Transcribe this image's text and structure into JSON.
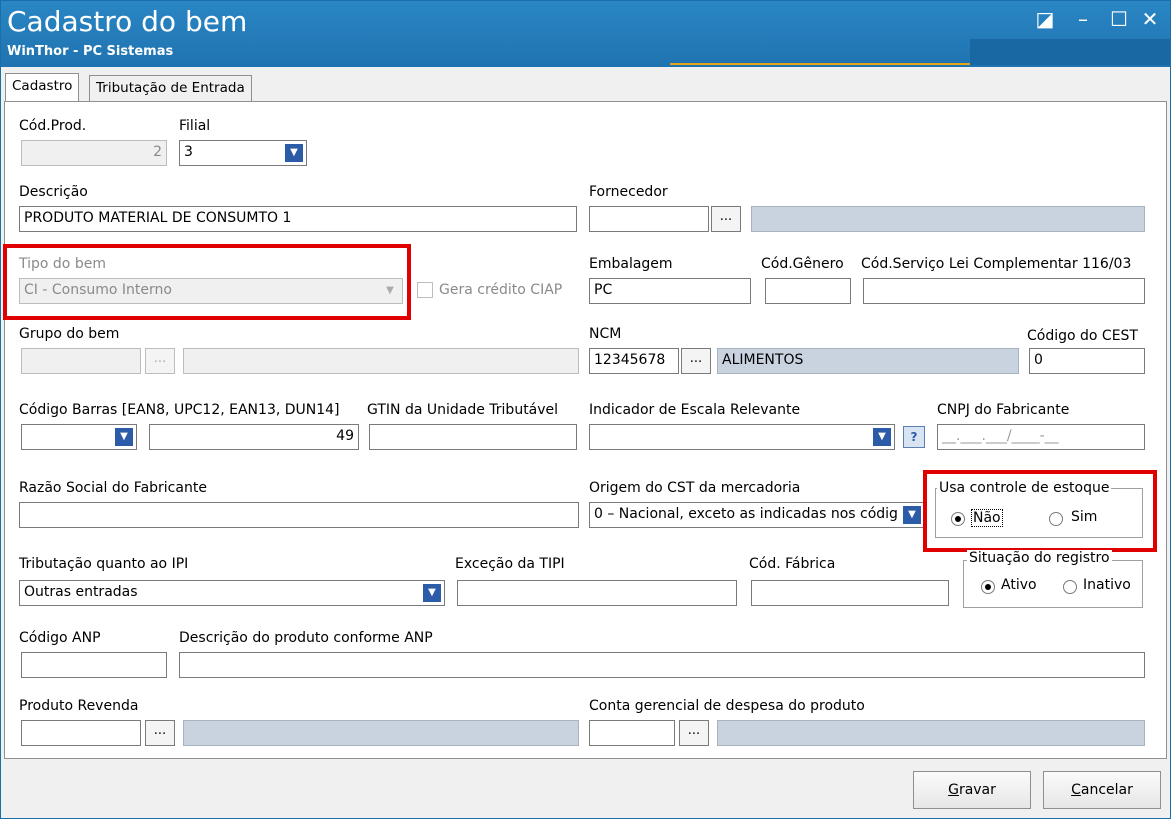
{
  "window": {
    "title": "Cadastro do bem",
    "subtitle": "WinThor - PC Sistemas",
    "controls": {
      "restore": "◪",
      "minimize": "–",
      "maximize": "☐",
      "close": "✕"
    }
  },
  "tabs": [
    {
      "label": "Cadastro",
      "active": true
    },
    {
      "label": "Tributação de Entrada",
      "active": false
    }
  ],
  "form": {
    "cod_prod": {
      "label": "Cód.Prod.",
      "value": "2"
    },
    "filial": {
      "label": "Filial",
      "value": "3"
    },
    "descricao": {
      "label": "Descrição",
      "value": "PRODUTO MATERIAL DE CONSUMTO 1"
    },
    "fornecedor": {
      "label": "Fornecedor",
      "value": "",
      "button": "..."
    },
    "tipo_bem": {
      "label": "Tipo do bem",
      "value": "CI - Consumo Interno"
    },
    "gera_credito": {
      "label": "Gera crédito CIAP",
      "checked": false
    },
    "embalagem": {
      "label": "Embalagem",
      "value": "PC"
    },
    "cod_genero": {
      "label": "Cód.Gênero",
      "value": ""
    },
    "cod_servico": {
      "label": "Cód.Serviço Lei Complementar 116/03",
      "value": ""
    },
    "grupo_bem": {
      "label": "Grupo do bem",
      "value": "",
      "button": "..."
    },
    "ncm": {
      "label": "NCM",
      "value": "12345678",
      "button": "...",
      "description": "ALIMENTOS"
    },
    "cest": {
      "label": "Código do CEST",
      "value": "0"
    },
    "cod_barras": {
      "label": "Código Barras [EAN8, UPC12, EAN13, DUN14]",
      "type_value": "",
      "value": "49"
    },
    "gtin": {
      "label": "GTIN da Unidade Tributável",
      "value": ""
    },
    "escala": {
      "label": "Indicador de Escala Relevante",
      "value": ""
    },
    "cnpj": {
      "label": "CNPJ do Fabricante",
      "mask": "__.___.___/____-__"
    },
    "razao_social": {
      "label": "Razão Social do Fabricante",
      "value": ""
    },
    "origem_cst": {
      "label": "Origem do CST da mercadoria",
      "value": "0 – Nacional, exceto as indicadas nos códig"
    },
    "estoque": {
      "label": "Usa controle de estoque",
      "options": [
        "Não",
        "Sim"
      ],
      "selected": "Não"
    },
    "situacao": {
      "label": "Situação do registro",
      "options": [
        "Ativo",
        "Inativo"
      ],
      "selected": "Ativo"
    },
    "tributacao_ipi": {
      "label": "Tributação quanto ao IPI",
      "value": "Outras entradas"
    },
    "excecao_tipi": {
      "label": "Exceção da TIPI",
      "value": ""
    },
    "cod_fabrica": {
      "label": "Cód. Fábrica",
      "value": ""
    },
    "codigo_anp": {
      "label": "Código ANP",
      "value": ""
    },
    "descricao_anp": {
      "label": "Descrição do produto conforme ANP",
      "value": ""
    },
    "produto_revenda": {
      "label": "Produto Revenda",
      "value": "",
      "button": "..."
    },
    "conta_gerencial": {
      "label": "Conta gerencial de despesa do produto",
      "value": "",
      "button": "..."
    }
  },
  "footer": {
    "gravar": {
      "mnemonic": "G",
      "rest": "ravar"
    },
    "cancelar": {
      "mnemonic": "C",
      "rest": "ancelar"
    }
  },
  "colors": {
    "highlight": "#e10000",
    "titlebar": "#1f73b0",
    "readonly": "#c9d3e0"
  }
}
